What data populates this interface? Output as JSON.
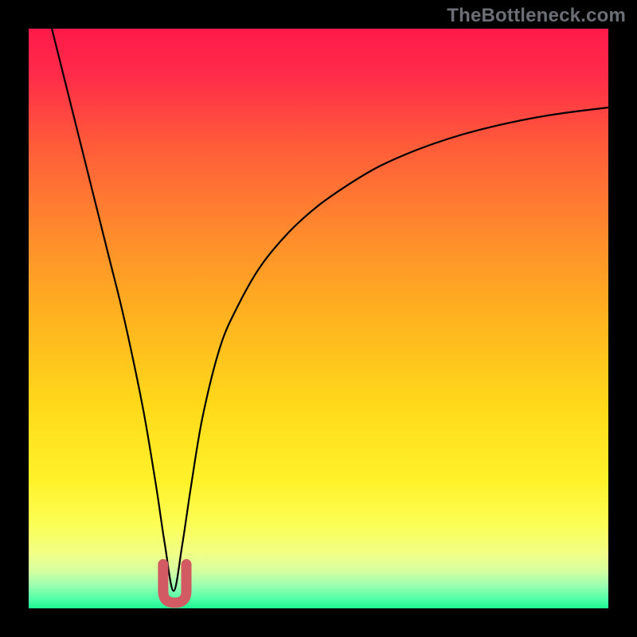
{
  "watermark": "TheBottleneck.com",
  "colors": {
    "frame": "#000000",
    "curve_stroke": "#000000",
    "marker_stroke": "#d15a63",
    "gradient_stops": [
      {
        "offset": 0.0,
        "color": "#ff1a4a"
      },
      {
        "offset": 0.08,
        "color": "#ff2b49"
      },
      {
        "offset": 0.2,
        "color": "#ff5b3a"
      },
      {
        "offset": 0.35,
        "color": "#ff8a2d"
      },
      {
        "offset": 0.5,
        "color": "#ffb31f"
      },
      {
        "offset": 0.65,
        "color": "#ffd91a"
      },
      {
        "offset": 0.78,
        "color": "#fff22a"
      },
      {
        "offset": 0.86,
        "color": "#fbff58"
      },
      {
        "offset": 0.905,
        "color": "#f1ff86"
      },
      {
        "offset": 0.935,
        "color": "#d6ffa0"
      },
      {
        "offset": 0.96,
        "color": "#9cffb0"
      },
      {
        "offset": 0.985,
        "color": "#4dffa7"
      },
      {
        "offset": 1.0,
        "color": "#1cf591"
      }
    ]
  },
  "chart_data": {
    "type": "line",
    "title": "",
    "xlabel": "",
    "ylabel": "",
    "xlim": [
      0,
      100
    ],
    "ylim": [
      0,
      100
    ],
    "annotations": [],
    "notes": "Bottleneck curve: y-axis is bottleneck percentage (0 at bottom, 100 at top). Curve dips to ~0 near x≈25 (minimum bottleneck), rising steeply on the left toward 100 at x≈4 and rising with diminishing slope on the right toward ~86 at x=100.",
    "minimum": {
      "x": 25,
      "y": 0
    },
    "series": [
      {
        "name": "bottleneck-curve",
        "color": "#000000",
        "x": [
          4,
          6,
          8,
          10,
          12,
          14,
          16,
          18,
          20,
          22,
          23.5,
          25,
          26.5,
          28,
          30,
          33,
          36,
          40,
          45,
          50,
          55,
          60,
          65,
          70,
          75,
          80,
          85,
          90,
          95,
          100
        ],
        "y": [
          100,
          92,
          84,
          76,
          68,
          60,
          52,
          43,
          33,
          21,
          11,
          3,
          11,
          21,
          33,
          45,
          52,
          59,
          65,
          69.5,
          73,
          76,
          78.3,
          80.2,
          81.8,
          83.1,
          84.2,
          85.1,
          85.8,
          86.4
        ]
      }
    ],
    "marker": {
      "name": "optimal-range-marker",
      "color": "#d15a63",
      "shape": "U",
      "x_range": [
        23.2,
        27.2
      ],
      "y_range": [
        0.0,
        7.6
      ]
    }
  }
}
